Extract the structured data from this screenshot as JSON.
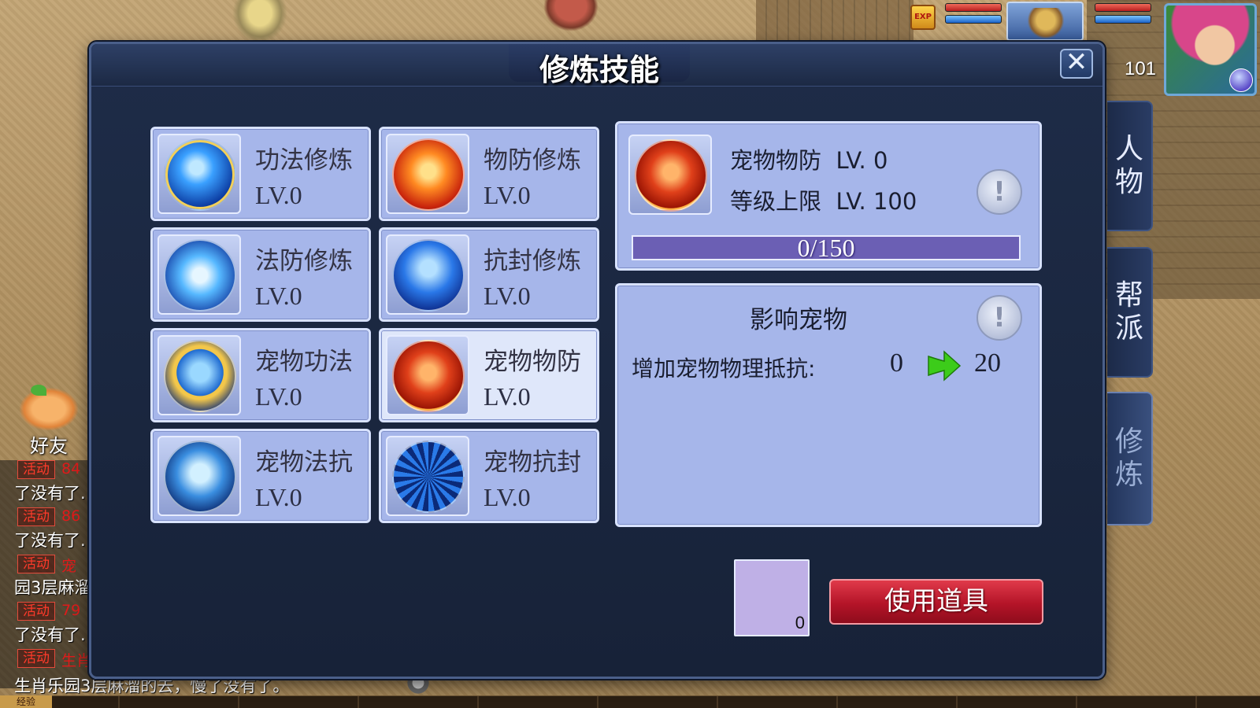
{
  "hud": {
    "exp_icon": "EXP",
    "player_level": "101"
  },
  "panel": {
    "title": "修炼技能",
    "close_icon": "✕"
  },
  "skills": [
    {
      "name": "功法修炼",
      "level": "LV.0",
      "icon": "blue-dragon-icon"
    },
    {
      "name": "物防修炼",
      "level": "LV.0",
      "icon": "fire-turtle-icon"
    },
    {
      "name": "法防修炼",
      "level": "LV.0",
      "icon": "aqua-shell-icon"
    },
    {
      "name": "抗封修炼",
      "level": "LV.0",
      "icon": "water-swirl-icon"
    },
    {
      "name": "宠物功法",
      "level": "LV.0",
      "icon": "blue-spirit-icon"
    },
    {
      "name": "宠物物防",
      "level": "LV.0",
      "icon": "flame-beast-icon",
      "selected": true
    },
    {
      "name": "宠物法抗",
      "level": "LV.0",
      "icon": "ghost-cat-icon"
    },
    {
      "name": "宠物抗封",
      "level": "LV.0",
      "icon": "shield-cat-icon"
    }
  ],
  "detail": {
    "name": "宠物物防",
    "level": "LV. 0",
    "cap_label": "等级上限",
    "cap_value": "LV. 100",
    "progress_text": "0/150",
    "progress_fraction": 0,
    "info_icon": "!"
  },
  "affect": {
    "title": "影响宠物",
    "info_icon": "!",
    "stat_label": "增加宠物物理抵抗:",
    "from": "0",
    "to": "20"
  },
  "item": {
    "count": "0",
    "use_button": "使用道具"
  },
  "tabs": [
    {
      "label": "人物"
    },
    {
      "label": "帮派"
    },
    {
      "label": "修炼",
      "active": true
    }
  ],
  "friend": {
    "label": "好友"
  },
  "chat": {
    "lines": [
      {
        "tag": "活动",
        "red": "84",
        "msg": "了没有了."
      },
      {
        "tag": "活动",
        "red": "86",
        "msg": "了没有了."
      },
      {
        "tag": "活动",
        "red": "宠",
        "msg": "园3层麻溜"
      },
      {
        "tag": "活动",
        "red": "79",
        "msg": "了没有了."
      },
      {
        "tag": "活动",
        "red": "生肖",
        "msg": ""
      }
    ],
    "bottom": "生肖乐园3层麻溜的去，慢了没有了。",
    "exp_label": "经验"
  }
}
